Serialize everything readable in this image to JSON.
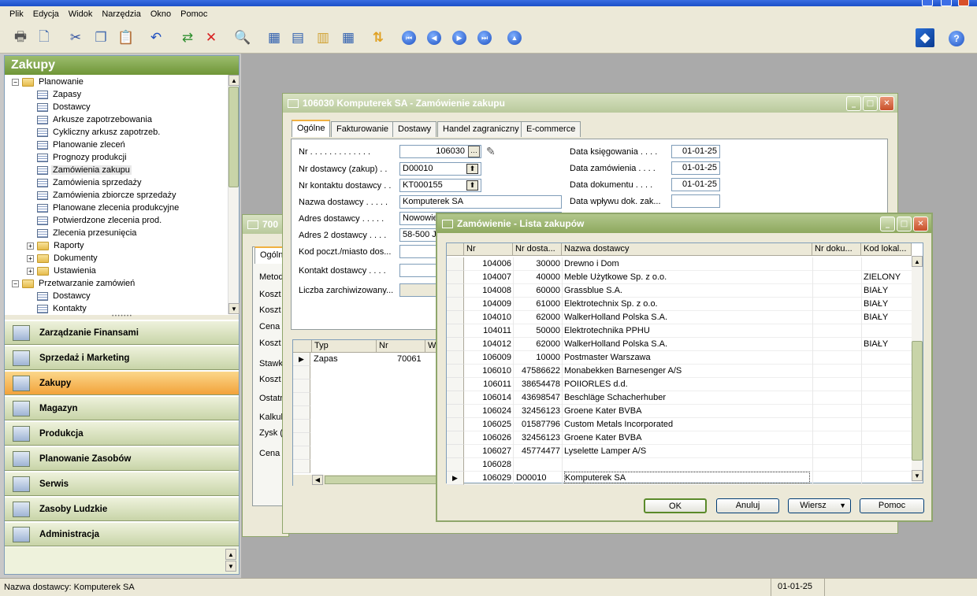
{
  "menu": [
    "Plik",
    "Edycja",
    "Widok",
    "Narzędzia",
    "Okno",
    "Pomoc"
  ],
  "nav": {
    "title": "Zakupy",
    "tree": [
      {
        "label": "Planowanie",
        "level": 0,
        "type": "folder",
        "exp": "−"
      },
      {
        "label": "Zapasy",
        "level": 1,
        "type": "list"
      },
      {
        "label": "Dostawcy",
        "level": 1,
        "type": "list"
      },
      {
        "label": "Arkusze zapotrzebowania",
        "level": 1,
        "type": "list"
      },
      {
        "label": "Cykliczny arkusz zapotrzeb.",
        "level": 1,
        "type": "list"
      },
      {
        "label": "Planowanie zleceń",
        "level": 1,
        "type": "list"
      },
      {
        "label": "Prognozy produkcji",
        "level": 1,
        "type": "list"
      },
      {
        "label": "Zamówienia zakupu",
        "level": 1,
        "type": "list",
        "selected": true
      },
      {
        "label": "Zamówienia sprzedaży",
        "level": 1,
        "type": "list"
      },
      {
        "label": "Zamówienia zbiorcze sprzedaży",
        "level": 1,
        "type": "list"
      },
      {
        "label": "Planowane zlecenia produkcyjne",
        "level": 1,
        "type": "list"
      },
      {
        "label": "Potwierdzone zlecenia prod.",
        "level": 1,
        "type": "list"
      },
      {
        "label": "Zlecenia przesunięcia",
        "level": 1,
        "type": "list"
      },
      {
        "label": "Raporty",
        "level": 1,
        "type": "folder",
        "exp": "+"
      },
      {
        "label": "Dokumenty",
        "level": 1,
        "type": "folder",
        "exp": "+"
      },
      {
        "label": "Ustawienia",
        "level": 1,
        "type": "folder",
        "exp": "+"
      },
      {
        "label": "Przetwarzanie zamówień",
        "level": 0,
        "type": "folder",
        "exp": "−"
      },
      {
        "label": "Dostawcy",
        "level": 1,
        "type": "list"
      },
      {
        "label": "Kontakty",
        "level": 1,
        "type": "list"
      }
    ],
    "buttons": [
      {
        "label": "Zarządzanie Finansami"
      },
      {
        "label": "Sprzedaż i Marketing"
      },
      {
        "label": "Zakupy",
        "active": true
      },
      {
        "label": "Magazyn"
      },
      {
        "label": "Produkcja"
      },
      {
        "label": "Planowanie Zasobów"
      },
      {
        "label": "Serwis"
      },
      {
        "label": "Zasoby Ludzkie"
      },
      {
        "label": "Administracja"
      }
    ]
  },
  "backwin": {
    "title": "700",
    "tab": "Ogólne",
    "labels": [
      "Metoda",
      "Koszt",
      "Koszt",
      "Cena",
      "Koszt",
      "Stawka",
      "Koszt",
      "Ostatn",
      "Kalkula",
      "Zysk (",
      "Cena"
    ]
  },
  "order": {
    "title": "106030 Komputerek SA - Zamówienie zakupu",
    "tabs": [
      "Ogólne",
      "Fakturowanie",
      "Dostawy",
      "Handel zagraniczny",
      "E-commerce"
    ],
    "fields_left": [
      {
        "label": "Nr . . . . . . . . . . . . .",
        "value": "106030"
      },
      {
        "label": "Nr dostawcy (zakup) . .",
        "value": "D00010"
      },
      {
        "label": "Nr kontaktu dostawcy . .",
        "value": "KT000155"
      },
      {
        "label": "Nazwa dostawcy . . . . .",
        "value": "Komputerek SA"
      },
      {
        "label": "Adres dostawcy . . . . .",
        "value": "Nowowie"
      },
      {
        "label": "Adres 2 dostawcy . . . .",
        "value": "58-500 J"
      },
      {
        "label": "Kod poczt./miasto dos...",
        "value": ""
      },
      {
        "label": "Kontakt dostawcy . . . .",
        "value": ""
      },
      {
        "label": "Liczba zarchiwizowany...",
        "value": ""
      }
    ],
    "fields_right": [
      {
        "label": "Data księgowania . . . .",
        "value": "01-01-25"
      },
      {
        "label": "Data zamówienia . . . .",
        "value": "01-01-25"
      },
      {
        "label": "Data dokumentu . . . .",
        "value": "01-01-25"
      },
      {
        "label": "Data wpływu dok. zak...",
        "value": ""
      }
    ],
    "lines": {
      "headers": [
        "Typ",
        "Nr",
        "Ws"
      ],
      "row": {
        "type": "Zapas",
        "nr": "70061"
      }
    }
  },
  "list": {
    "title": "Zamówienie - Lista zakupów",
    "headers": [
      "Nr",
      "Nr dosta...",
      "Nazwa dostawcy",
      "Nr doku...",
      "Kod lokal..."
    ],
    "rows": [
      {
        "nr": "104006",
        "vendor": "30000",
        "name": "Drewno i Dom",
        "loc": ""
      },
      {
        "nr": "104007",
        "vendor": "40000",
        "name": "Meble Użytkowe Sp. z o.o.",
        "loc": "ZIELONY"
      },
      {
        "nr": "104008",
        "vendor": "60000",
        "name": "Grassblue S.A.",
        "loc": "BIAŁY"
      },
      {
        "nr": "104009",
        "vendor": "61000",
        "name": "Elektrotechnix Sp. z o.o.",
        "loc": "BIAŁY"
      },
      {
        "nr": "104010",
        "vendor": "62000",
        "name": "WalkerHolland Polska S.A.",
        "loc": "BIAŁY"
      },
      {
        "nr": "104011",
        "vendor": "50000",
        "name": "Elektrotechnika PPHU",
        "loc": ""
      },
      {
        "nr": "104012",
        "vendor": "62000",
        "name": "WalkerHolland Polska S.A.",
        "loc": "BIAŁY"
      },
      {
        "nr": "106009",
        "vendor": "10000",
        "name": "Postmaster Warszawa",
        "loc": ""
      },
      {
        "nr": "106010",
        "vendor": "47586622",
        "name": "Monabekken Barnesenger A/S",
        "loc": ""
      },
      {
        "nr": "106011",
        "vendor": "38654478",
        "name": "POIIORLES d.d.",
        "loc": ""
      },
      {
        "nr": "106014",
        "vendor": "43698547",
        "name": "Beschläge Schacherhuber",
        "loc": ""
      },
      {
        "nr": "106024",
        "vendor": "32456123",
        "name": "Groene Kater BVBA",
        "loc": ""
      },
      {
        "nr": "106025",
        "vendor": "01587796",
        "name": "Custom Metals Incorporated",
        "loc": ""
      },
      {
        "nr": "106026",
        "vendor": "32456123",
        "name": "Groene Kater BVBA",
        "loc": ""
      },
      {
        "nr": "106027",
        "vendor": "45774477",
        "name": "Lyselette Lamper A/S",
        "loc": ""
      },
      {
        "nr": "106028",
        "vendor": "",
        "name": "",
        "loc": ""
      },
      {
        "nr": "106029",
        "vendor": "D00010",
        "name": "Komputerek SA",
        "loc": "",
        "current": true
      }
    ],
    "buttons": {
      "ok": "OK",
      "cancel": "Anuluj",
      "line": "Wiersz",
      "help": "Pomoc"
    }
  },
  "status": {
    "text": "Nazwa dostawcy: Komputerek SA",
    "date": "01-01-25"
  }
}
